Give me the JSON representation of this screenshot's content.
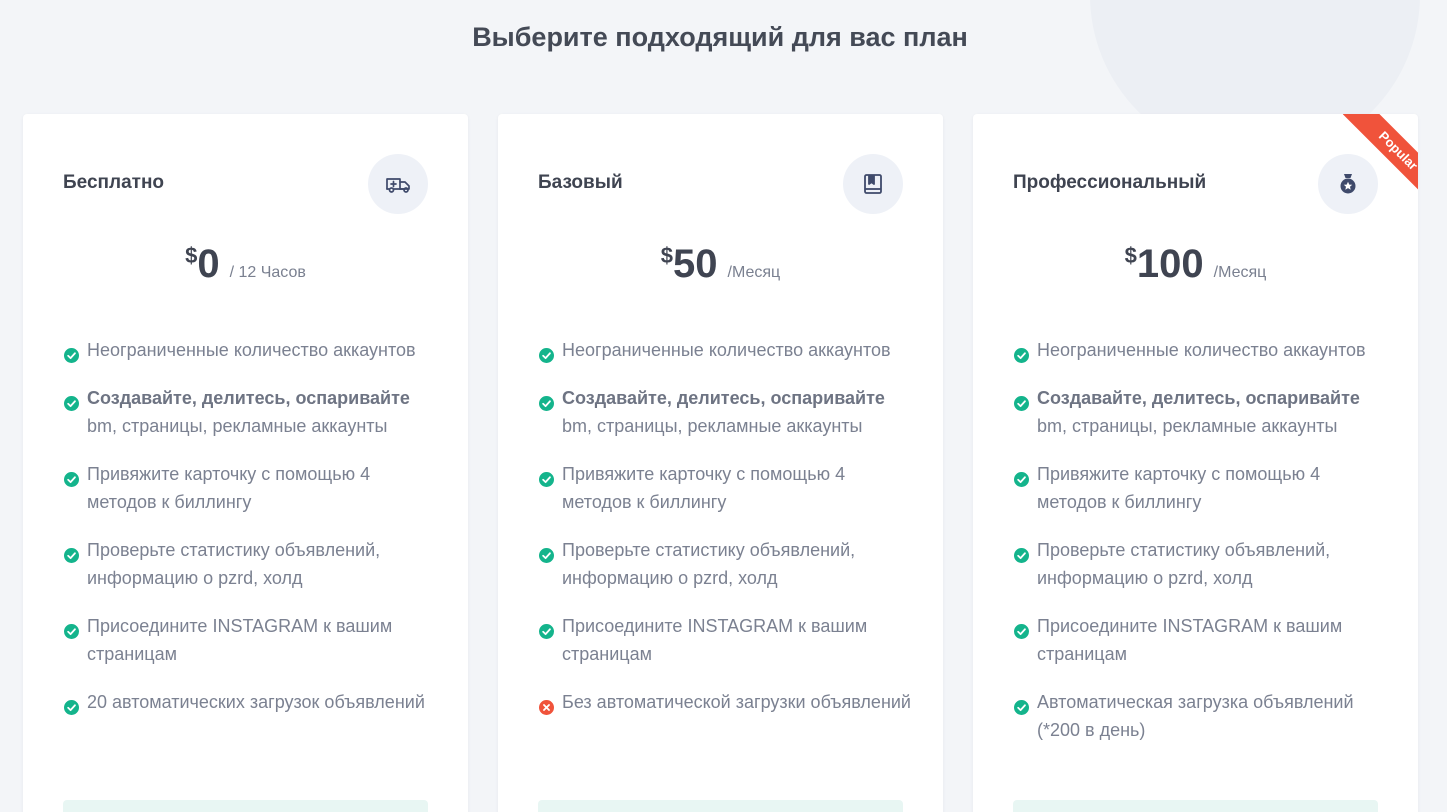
{
  "page": {
    "title": "Выберите подходящий для вас план"
  },
  "colors": {
    "check": "#14b48c",
    "cross": "#f0533b",
    "ribbon": "#f0533b",
    "icon": "#3f4a6b"
  },
  "plans": [
    {
      "name": "Бесплатно",
      "icon": "ambulance-icon",
      "currency": "$",
      "amount": "0",
      "period": "/ 12 Часов",
      "features": [
        {
          "status": "check",
          "bold": "",
          "text": "Неограниченные количество аккаунтов"
        },
        {
          "status": "check",
          "bold": "Создавайте, делитесь, оспаривайте",
          "text": " bm, страницы, рекламные аккаунты"
        },
        {
          "status": "check",
          "bold": "",
          "text": "Привяжите карточку с помощью 4 методов к биллингу"
        },
        {
          "status": "check",
          "bold": "",
          "text": "Проверьте статистику объявлений, информацию о pzrd, холд"
        },
        {
          "status": "check",
          "bold": "",
          "text": "Присоедините INSTAGRAM к вашим страницам"
        },
        {
          "status": "check",
          "bold": "",
          "text": "20 автоматических загрузок объявлений"
        }
      ]
    },
    {
      "name": "Базовый",
      "icon": "book-icon",
      "currency": "$",
      "amount": "50",
      "period": "/Месяц",
      "features": [
        {
          "status": "check",
          "bold": "",
          "text": "Неограниченные количество аккаунтов"
        },
        {
          "status": "check",
          "bold": "Создавайте, делитесь, оспаривайте",
          "text": " bm, страницы, рекламные аккаунты"
        },
        {
          "status": "check",
          "bold": "",
          "text": "Привяжите карточку с помощью 4 методов к биллингу"
        },
        {
          "status": "check",
          "bold": "",
          "text": "Проверьте статистику объявлений, информацию о pzrd, холд"
        },
        {
          "status": "check",
          "bold": "",
          "text": "Присоедините INSTAGRAM к вашим страницам"
        },
        {
          "status": "cross",
          "bold": "",
          "text": "Без автоматической загрузки объявлений"
        }
      ]
    },
    {
      "name": "Профессиональный",
      "icon": "medal-icon",
      "currency": "$",
      "amount": "100",
      "period": "/Месяц",
      "badge": "Popular",
      "features": [
        {
          "status": "check",
          "bold": "",
          "text": "Неограниченные количество аккаунтов"
        },
        {
          "status": "check",
          "bold": "Создавайте, делитесь, оспаривайте",
          "text": " bm, страницы, рекламные аккаунты"
        },
        {
          "status": "check",
          "bold": "",
          "text": "Привяжите карточку с помощью 4 методов к биллингу"
        },
        {
          "status": "check",
          "bold": "",
          "text": "Проверьте статистику объявлений, информацию о pzrd, холд"
        },
        {
          "status": "check",
          "bold": "",
          "text": "Присоедините INSTAGRAM к вашим страницам"
        },
        {
          "status": "check",
          "bold": "",
          "text": "Автоматическая загрузка объявлений (*200 в день)"
        }
      ]
    }
  ]
}
